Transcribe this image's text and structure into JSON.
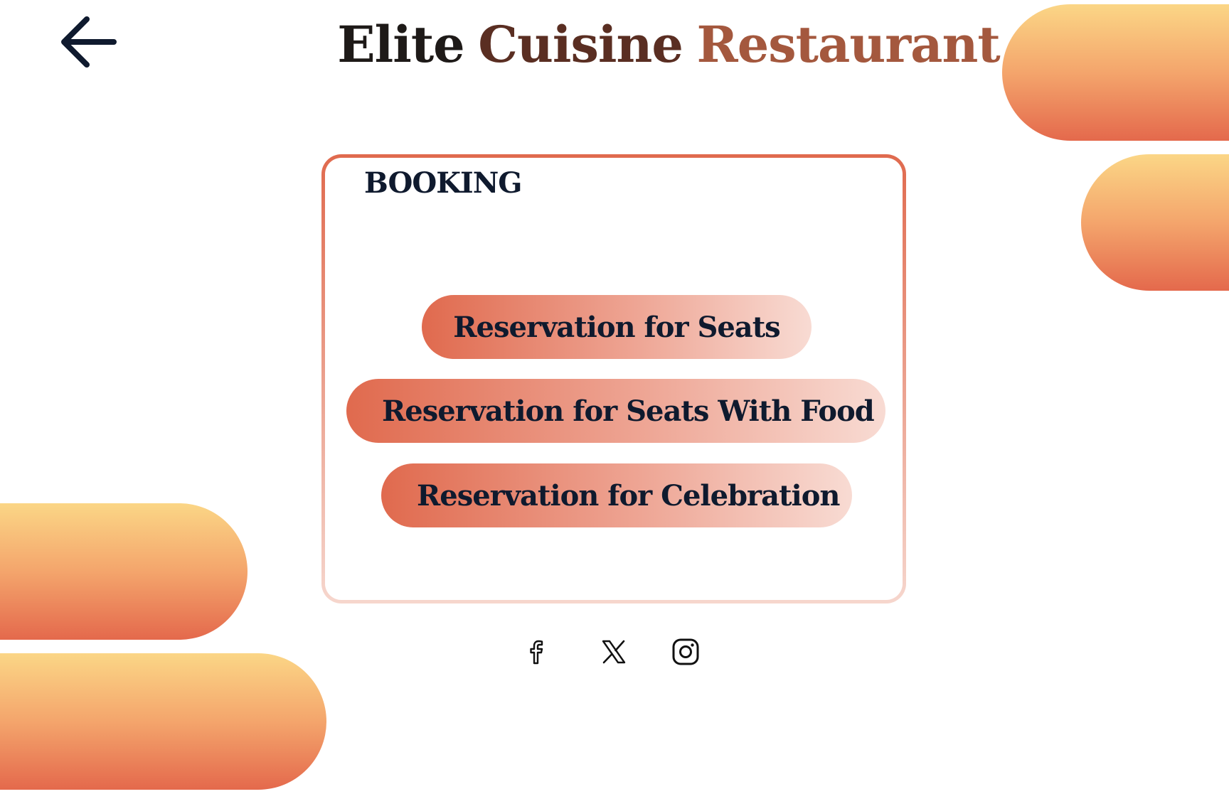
{
  "header": {
    "back_label": "Back",
    "title_words": [
      "Elite",
      "Cuisine",
      "Restaurant"
    ]
  },
  "booking": {
    "heading": "BOOKING",
    "options": [
      "Reservation for Seats",
      "Reservation for Seats With Food",
      "Reservation for Celebration"
    ]
  },
  "social": {
    "icons": [
      "facebook-icon",
      "x-icon",
      "instagram-icon"
    ]
  },
  "colors": {
    "accent": "#e06a4e",
    "title_dark": "#1e1a18",
    "title_brown": "#5a2e22",
    "title_rust": "#a4583e",
    "text_dark": "#0f1a2e",
    "pill_top": "#fbd686",
    "pill_bottom": "#e4694c"
  }
}
